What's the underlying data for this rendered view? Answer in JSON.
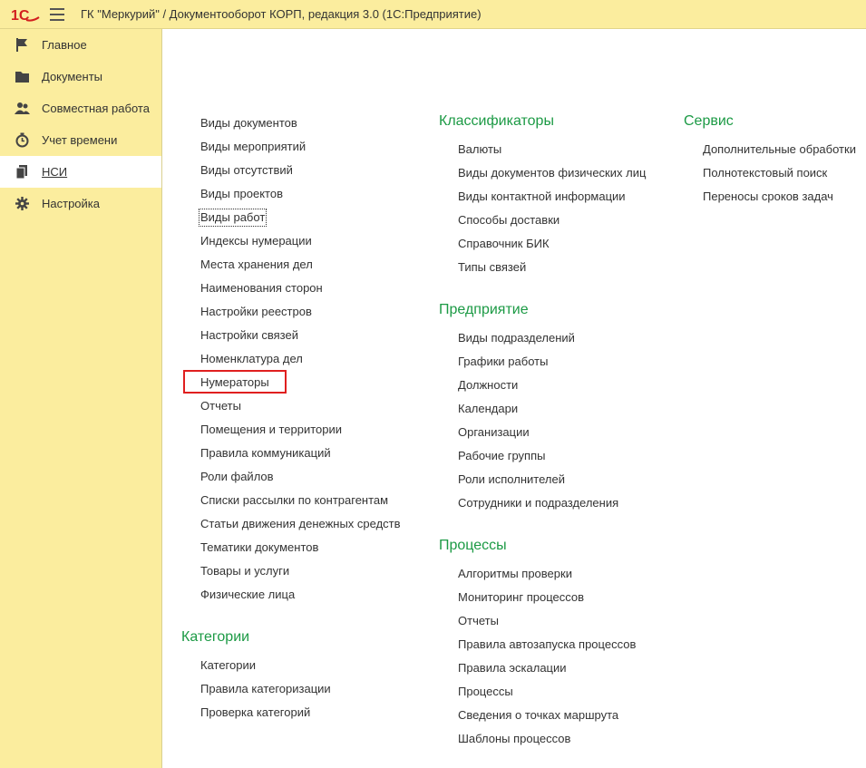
{
  "window": {
    "title": "ГК \"Меркурий\" / Документооборот КОРП, редакция 3.0  (1С:Предприятие)",
    "logo_text": "1С"
  },
  "sidebar": {
    "items": [
      {
        "label": "Главное",
        "icon": "flag-icon"
      },
      {
        "label": "Документы",
        "icon": "folder-icon"
      },
      {
        "label": "Совместная работа",
        "icon": "people-icon"
      },
      {
        "label": "Учет времени",
        "icon": "timer-icon"
      },
      {
        "label": "НСИ",
        "icon": "books-icon",
        "active": true
      },
      {
        "label": "Настройка",
        "icon": "gear-icon"
      }
    ]
  },
  "main": {
    "col1": {
      "links": [
        "Виды документов",
        "Виды мероприятий",
        "Виды отсутствий",
        "Виды проектов",
        "Виды работ",
        "Индексы нумерации",
        "Места хранения дел",
        "Наименования сторон",
        "Настройки реестров",
        "Настройки связей",
        "Номенклатура дел",
        "Нумераторы",
        "Отчеты",
        "Помещения и территории",
        "Правила коммуникаций",
        "Роли файлов",
        "Списки рассылки по контрагентам",
        "Статьи движения денежных средств",
        "Тематики документов",
        "Товары и услуги",
        "Физические лица"
      ],
      "categories": {
        "heading": "Категории",
        "links": [
          "Категории",
          "Правила категоризации",
          "Проверка категорий"
        ]
      }
    },
    "col2": {
      "sections": [
        {
          "heading": "Классификаторы",
          "links": [
            "Валюты",
            "Виды документов физических лиц",
            "Виды контактной информации",
            "Способы доставки",
            "Справочник БИК",
            "Типы связей"
          ]
        },
        {
          "heading": "Предприятие",
          "links": [
            "Виды подразделений",
            "Графики работы",
            "Должности",
            "Календари",
            "Организации",
            "Рабочие группы",
            "Роли исполнителей",
            "Сотрудники и подразделения"
          ]
        },
        {
          "heading": "Процессы",
          "links": [
            "Алгоритмы проверки",
            "Мониторинг процессов",
            "Отчеты",
            "Правила автозапуска процессов",
            "Правила эскалации",
            "Процессы",
            "Сведения о точках маршрута",
            "Шаблоны процессов"
          ]
        }
      ]
    },
    "col3": {
      "heading": "Сервис",
      "links": [
        "Дополнительные обработки",
        "Полнотекстовый поиск",
        "Переносы сроков задач"
      ]
    }
  },
  "colors": {
    "panel_bg": "#fbed9e",
    "heading_green": "#1c9a45",
    "highlight_red": "#e01f1f"
  }
}
